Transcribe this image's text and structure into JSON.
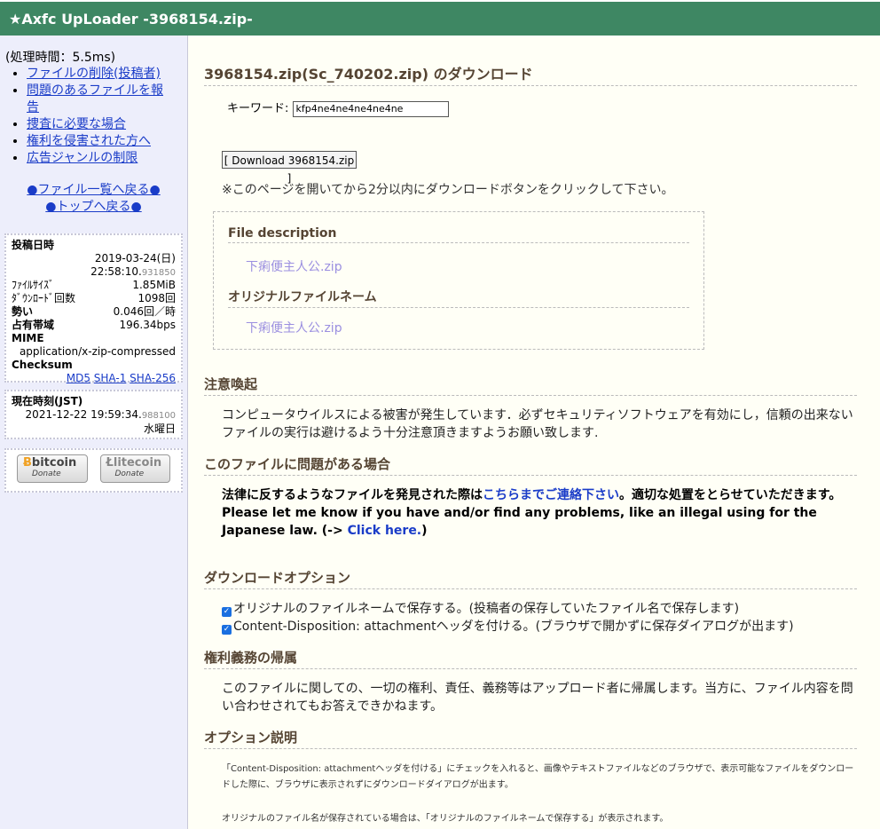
{
  "header": {
    "title": "★Axfc UpLoader -3968154.zip-"
  },
  "sidebar": {
    "processing_time": "(処理時間：5.5ms)",
    "links": [
      "ファイルの削除(投稿者)",
      "問題のあるファイルを報",
      "告",
      "捜査に必要な場合",
      "権利を侵害された方へ",
      "広告ジャンルの制限"
    ],
    "nav_file_list": "●ファイル一覧へ戻る●",
    "nav_top": "●トップへ戻る●",
    "info": {
      "posted_label": "投稿日時",
      "posted_date": "2019-03-24(日)",
      "posted_time": "22:58:10.",
      "posted_time_small": "931850",
      "size_label": "ﾌｧｲﾙｻｲｽﾞ",
      "size_value": "1.85MiB",
      "downloads_label": "ﾀﾞｳﾝﾛｰﾄﾞ回数",
      "downloads_value": "1098回",
      "momentum_label": "勢い",
      "momentum_value": "0.046回／時",
      "bandwidth_label": "占有帯域",
      "bandwidth_value": "196.34bps",
      "mime_label": "MIME",
      "mime_value": "application/x-zip-compressed",
      "checksum_label": "Checksum",
      "md5": "MD5",
      "sha1": "SHA-1",
      "sha256": "SHA-256"
    },
    "time": {
      "label": "現在時刻(JST)",
      "datetime": "2021-12-22 19:59:34.",
      "datetime_small": "988100",
      "weekday": "水曜日"
    },
    "donate": {
      "bitcoin": "bitcoin",
      "litecoin": "litecoin",
      "donate_label": "Donate"
    }
  },
  "main": {
    "download_title": "3968154.zip(Sc_740202.zip) のダウンロード",
    "keyword_label": "キーワード:",
    "keyword_value": "kfp4ne4ne4ne4ne4ne",
    "download_button": "[ Download 3968154.zip ]",
    "download_notice": "※このページを開いてから2分以内にダウンロードボタンをクリックして下さい。",
    "file_description_label": "File description",
    "file_description_value": "下痢便主人公.zip",
    "original_name_label": "オリジナルファイルネーム",
    "original_name_value": "下痢便主人公.zip",
    "caution_title": "注意喚起",
    "caution_text": "コンピュータウイルスによる被害が発生しています．必ずセキュリティソフトウェアを有効にし，信頼の出来ないファイルの実行は避けるよう十分注意頂きますようお願い致します.",
    "problem_title": "このファイルに問題がある場合",
    "problem_text_pre": "法律に反するようなファイルを発見された際は",
    "problem_link": "こちらまでご連絡下さい",
    "problem_text_post": "。適切な処置をとらせていただきます。",
    "problem_en_pre": "Please let me know if you have and/or find any problems, like an illegal using for the Japanese law. (-> ",
    "problem_en_link": "Click here.",
    "problem_en_post": ")",
    "options_title": "ダウンロードオプション",
    "option1": "オリジナルのファイルネームで保存する。(投稿者の保存していたファイル名で保存します)",
    "option2": "Content-Disposition: attachmentヘッダを付ける。(ブラウザで開かずに保存ダイアログが出ます)",
    "rights_title": "権利義務の帰属",
    "rights_text": "このファイルに関しての、一切の権利、責任、義務等はアップロード者に帰属します。当方に、ファイル内容を問い合わせされてもお答えできかねます。",
    "explain_title": "オプション説明",
    "explain_text1": "「Content-Disposition: attachmentヘッダを付ける」にチェックを入れると、画像やテキストファイルなどのブラウザで、表示可能なファイルをダウンロードした際に、ブラウザに表示されずにダウンロードダイアログが出ます。",
    "explain_text2": "オリジナルのファイル名が保存されている場合は、「オリジナルのファイルネームで保存する」が表示されます。"
  }
}
